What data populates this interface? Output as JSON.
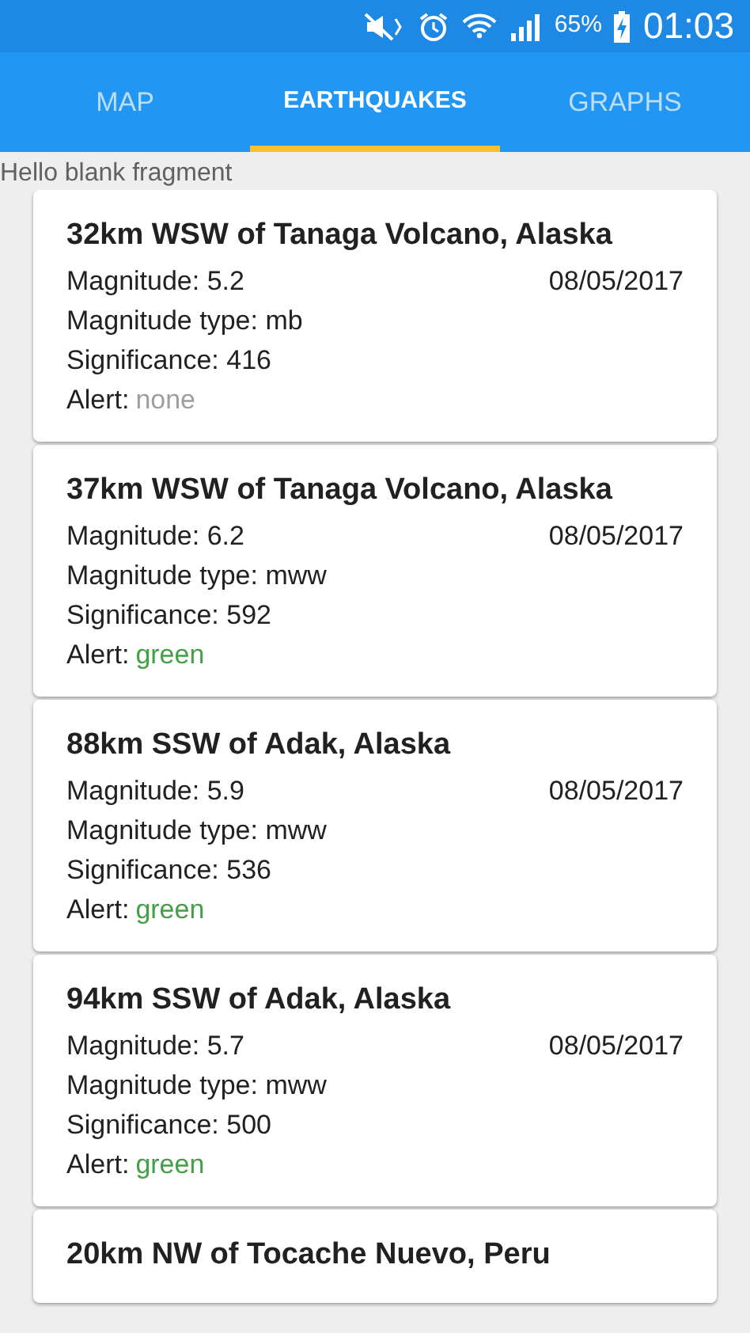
{
  "status_bar": {
    "battery": "65%",
    "time": "01:03"
  },
  "tabs": [
    {
      "label": "MAP",
      "selected": false
    },
    {
      "label": "EARTHQUAKES",
      "selected": true
    },
    {
      "label": "GRAPHS",
      "selected": false
    }
  ],
  "fragment_text": "Hello blank fragment",
  "earthquakes": [
    {
      "title": "32km WSW of Tanaga Volcano, Alaska",
      "magnitude": "Magnitude: 5.2",
      "date": "08/05/2017",
      "magnitude_type": "Magnitude type: mb",
      "significance": "Significance: 416",
      "alert_label": "Alert:",
      "alert": "none",
      "color": "#9e9e9e"
    },
    {
      "title": "37km WSW of Tanaga Volcano, Alaska",
      "magnitude": "Magnitude: 6.2",
      "date": "08/05/2017",
      "magnitude_type": "Magnitude type: mww",
      "significance": "Significance: 592",
      "alert_label": "Alert:",
      "alert": "green",
      "color": "#43a047"
    },
    {
      "title": "88km SSW of Adak, Alaska",
      "magnitude": "Magnitude: 5.9",
      "date": "08/05/2017",
      "magnitude_type": "Magnitude type: mww",
      "significance": "Significance: 536",
      "alert_label": "Alert:",
      "alert": "green",
      "color": "#43a047"
    },
    {
      "title": "94km SSW of Adak, Alaska",
      "magnitude": "Magnitude: 5.7",
      "date": "08/05/2017",
      "magnitude_type": "Magnitude type: mww",
      "significance": "Significance: 500",
      "alert_label": "Alert:",
      "alert": "green",
      "color": "#43a047"
    },
    {
      "title": "20km NW of Tocache Nuevo, Peru"
    }
  ]
}
